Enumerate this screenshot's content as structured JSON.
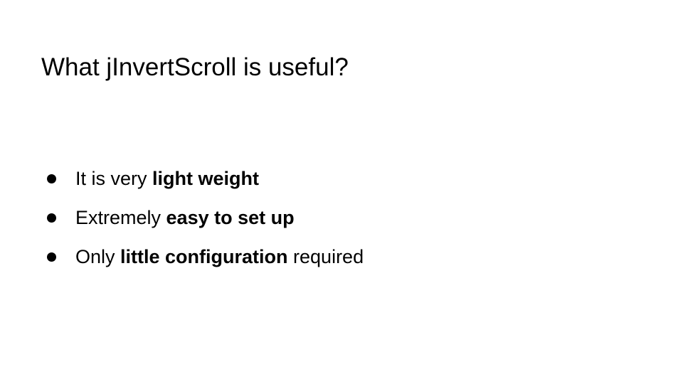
{
  "slide": {
    "title": "What jInvertScroll is useful?",
    "bullets": [
      {
        "pre": "It is very ",
        "bold": "light weight",
        "post": ""
      },
      {
        "pre": "Extremely ",
        "bold": "easy to set up",
        "post": ""
      },
      {
        "pre": "Only ",
        "bold": "little configuration",
        "post": " required"
      }
    ]
  }
}
